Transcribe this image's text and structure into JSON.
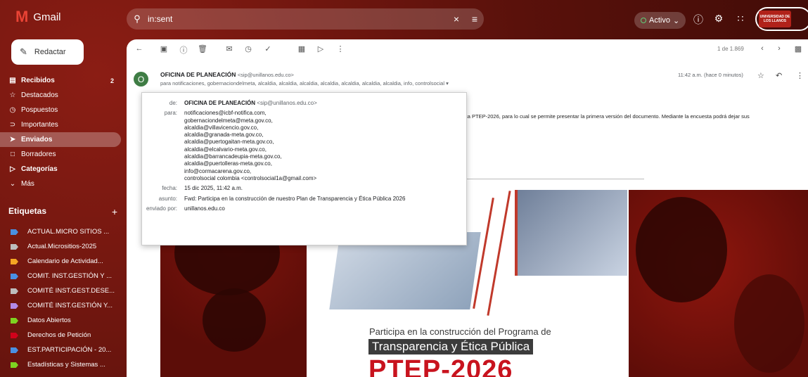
{
  "app": {
    "name": "Gmail"
  },
  "search": {
    "value": "in:sent"
  },
  "status": {
    "label": "Activo"
  },
  "account": {
    "badge_text": "UNIVERSIDAD DE LOS LLANOS",
    "partial_initial": "C"
  },
  "sidebar": {
    "compose_label": "Redactar",
    "items": [
      {
        "label": "Recibidos",
        "count": "2",
        "icon": "inbox-icon"
      },
      {
        "label": "Destacados",
        "icon": "star-icon"
      },
      {
        "label": "Pospuestos",
        "icon": "clock-icon"
      },
      {
        "label": "Importantes",
        "icon": "important-icon"
      },
      {
        "label": "Enviados",
        "icon": "send-icon"
      },
      {
        "label": "Borradores",
        "icon": "draft-icon"
      },
      {
        "label": "Categorías",
        "icon": "label-icon"
      },
      {
        "label": "Más",
        "icon": "chevron-down-icon"
      }
    ],
    "labels_title": "Etiquetas",
    "labels": [
      {
        "label": "ACTUAL.MICRO SITIOS ...",
        "color": "#4a90e2"
      },
      {
        "label": "Actual.Micrositios-2025",
        "color": "#bdbdbd"
      },
      {
        "label": "Calendario de Actividad...",
        "color": "#f5a623"
      },
      {
        "label": "COMIT. INST.GESTIÓN Y ...",
        "color": "#4a90e2"
      },
      {
        "label": "COMITÉ INST.GEST.DESE...",
        "color": "#bdbdbd"
      },
      {
        "label": "COMITÉ INST.GESTIÓN Y...",
        "color": "#b38ae8"
      },
      {
        "label": "Datos Abiertos",
        "color": "#7ed321"
      },
      {
        "label": "Derechos de Petición",
        "color": "#d0021b"
      },
      {
        "label": "EST.PARTICIPACIÓN - 20...",
        "color": "#4a90e2"
      },
      {
        "label": "Estadísticas y Sistemas ...",
        "color": "#7ed321"
      }
    ]
  },
  "toolbar": {
    "pager": "1 de 1.869"
  },
  "message": {
    "avatar_initial": "O",
    "sender_name": "OFICINA DE PLANEACIÓN",
    "sender_email": "<sip@unillanos.edu.co>",
    "to_line": "para notificaciones, gobernaciondelmeta, alcaldia, alcaldia, alcaldia, alcaldia, alcaldia, alcaldia, alcaldia, info, controlsocial",
    "time": "11:42 a.m. (hace 0 minutos)",
    "body_text": "ca PTEP-2026, para lo cual se permite presentar la primera versión del documento. Mediante la encuesta podrá dejar sus"
  },
  "details": {
    "from_label": "de:",
    "from_name": "OFICINA DE PLANEACIÓN",
    "from_email": "<sip@unillanos.edu.co>",
    "to_label": "para:",
    "to_list": [
      "notificaciones@icbf-notifica.com,",
      "gobernaciondelmeta@meta.gov.co,",
      "alcaldia@villavicencio.gov.co,",
      "alcaldia@granada-meta.gov.co,",
      "alcaldia@puertogaitan-meta.gov.co,",
      "alcaldia@elcalvario-meta.gov.co,",
      "alcaldia@barrancadeupia-meta.gov.co,",
      "alcaldia@puertolleras-meta.gov.co,",
      "info@cormacarena.gov.co,",
      "controlsocial colombia <controlsocial1a@gmail.com>"
    ],
    "date_label": "fecha:",
    "date_value": "15 dic 2025, 11:42 a.m.",
    "subject_label": "asunto:",
    "subject_value": "Fwd: Participa en la construcción de nuestro Plan de Transparencia y Ética Pública 2026",
    "sent_by_label": "enviado por:",
    "sent_by_value": "unillanos.edu.co"
  },
  "banner": {
    "line1": "Participa en la construcción del  Programa de",
    "line2": "Transparencia y Ética Pública",
    "line3": "PTEP-2026"
  }
}
